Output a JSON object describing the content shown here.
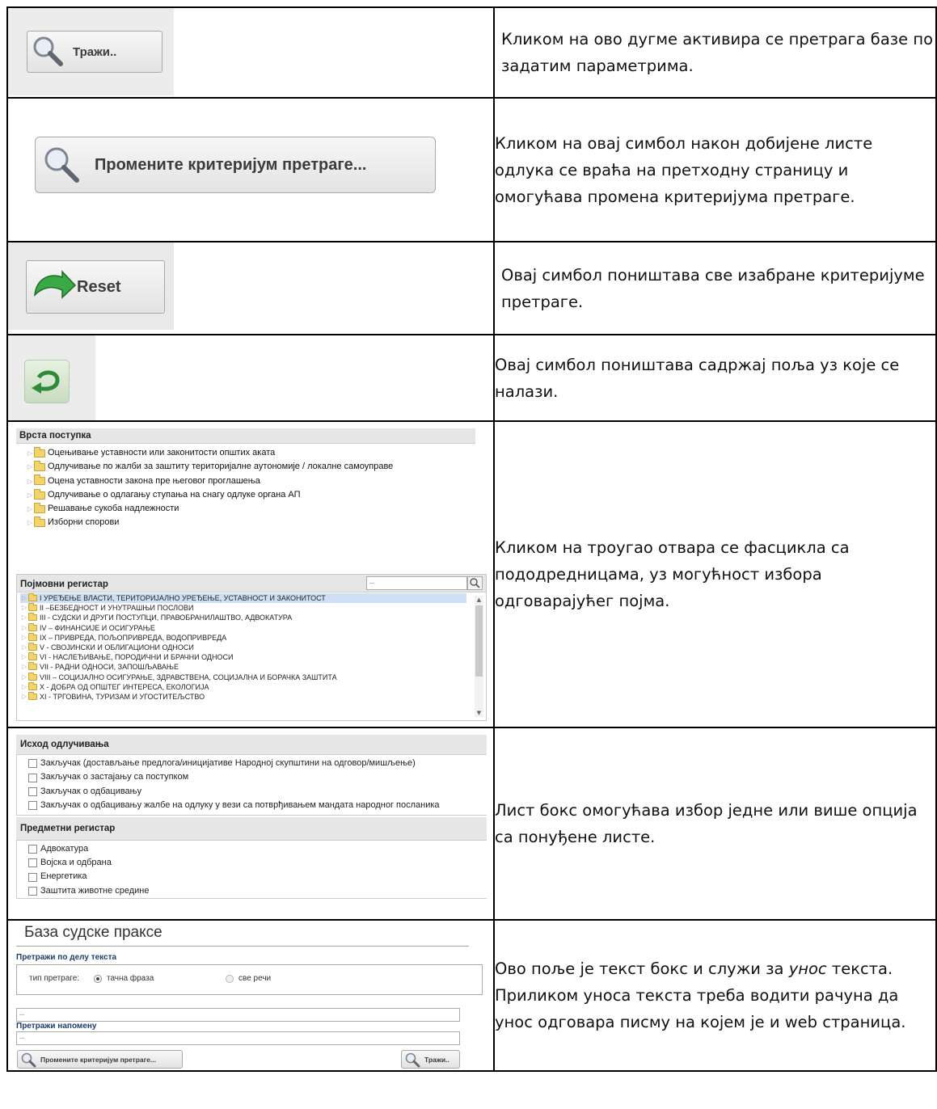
{
  "rows": [
    {
      "button_label": "Тражи..",
      "description": "Кликом на ово дугме активира се претрага базе по задатим параметрима."
    },
    {
      "button_label": "Промените критеријум претраге...",
      "description": "Кликом на овај симбол након добијене листе одлука се враћа на претходну страницу и омогућава промена критеријума претраге."
    },
    {
      "button_label": "Reset",
      "description": "Овај симбол поништава све изабране критеријуме претраге."
    },
    {
      "description": "Овај симбол поништава садржај поља уз које се налази."
    },
    {
      "description": "Кликом на троугао отвара се фасцикла са пододредницама, уз могућност избора одговарајућег појма."
    },
    {
      "description": "Лист бокс омогућава избор једне или више опција са понуђене листе."
    },
    {
      "description_before": "Ово поље је текст бокс и служи за ",
      "description_em": "унос",
      "description_after": " текста. Приликом уноса текста треба водити рачуна да унос одговара писму на којем је и web страница."
    }
  ],
  "vrsta_postupka": {
    "title": "Врста поступка",
    "items": [
      "Оцењивање уставности или законитости општих аката",
      "Одлучивање по жалби за заштиту територијалне аутономије / локалне самоуправе",
      "Оцена уставности закона пре његовог проглашења",
      "Одлучивање о одлагању ступања на снагу одлуке органа АП",
      "Решавање сукоба надлежности",
      "Изборни спорови"
    ]
  },
  "pojmovni_registar": {
    "title": "Појмовни регистар",
    "search_value": "--",
    "items": [
      "I УРЕЂЕЊЕ ВЛАСТИ, ТЕРИТОРИЈАЛНО УРЕЂЕЊЕ, УСТАВНОСТ И ЗАКОНИТОСТ",
      "II –БЕЗБЕДНОСТ И УНУТРАШЊИ ПОСЛОВИ",
      "III - СУДСКИ И ДРУГИ ПОСТУПЦИ, ПРАВОБРАНИЛАШТВО, АДВОКАТУРА",
      "IV – ФИНАНСИЈЕ И ОСИГУРАЊЕ",
      "IX – ПРИВРЕДА, ПОЉОПРИВРЕДА, ВОДОПРИВРЕДА",
      "V - СВОЈИНСКИ И ОБЛИГАЦИОНИ ОДНОСИ",
      "VI - НАСЛЕЂИВАЊЕ, ПОРОДИЧНИ И БРАЧНИ ОДНОСИ",
      "VII - РАДНИ ОДНОСИ, ЗАПОШЉАВАЊЕ",
      "VIII – СОЦИЈАЛНО ОСИГУРАЊЕ, ЗДРАВСТВЕНА, СОЦИЈАЛНА И БОРАЧКА ЗАШТИТА",
      "X - ДОБРА ОД ОПШТЕГ ИНТЕРЕСА, ЕКОЛОГИЈА",
      "XI - ТРГОВИНА, ТУРИЗАМ И УГОСТИТЕЉСТВО"
    ]
  },
  "ishod": {
    "title": "Исход одлучивања",
    "items": [
      "Закључак (достављање предлога/иницијативе Народној скупштини на одговор/мишљење)",
      "Закључак о застајању са поступком",
      "Закључак о одбацивању",
      "Закључак о одбацивању жалбе на одлуку у вези са потврђивањем мандата народног посланика"
    ]
  },
  "predmetni": {
    "title": "Предметни регистар",
    "items": [
      "Адвокатура",
      "Војска и одбрана",
      "Енергетика",
      "Заштита животне средине"
    ]
  },
  "baza": {
    "title": "База судске праксе",
    "section1": "Претражи по делу текста",
    "search_type_label": "тип претраге:",
    "radio1": "тачна фраза",
    "radio2": "све речи",
    "text1": "--",
    "section2": "Претражи напомену",
    "text2": "--",
    "change_btn": "Промените критеријум претраге...",
    "search_btn": "Тражи.."
  },
  "colors": {
    "reset_arrow": "#2f9a3a",
    "selected_row": "#cfe0f5"
  }
}
